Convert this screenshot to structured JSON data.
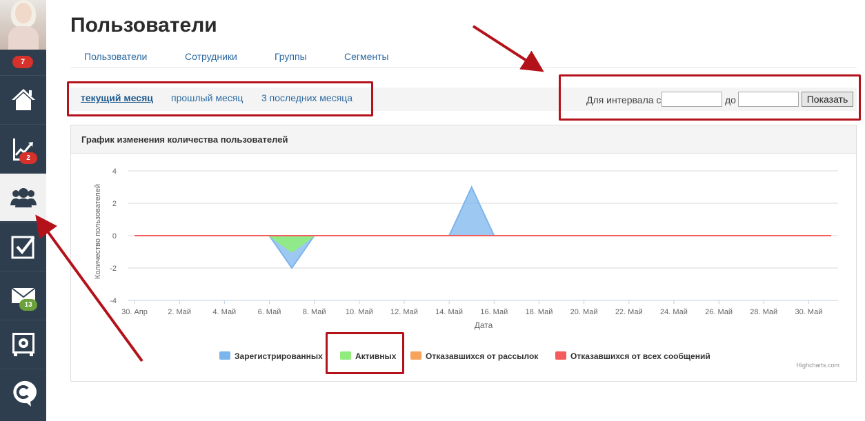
{
  "sidebar": {
    "top_badge": "7",
    "items": [
      {
        "name": "home",
        "icon": "home-icon",
        "badge": ""
      },
      {
        "name": "analytics",
        "icon": "chart-trend-icon",
        "badge": "2",
        "badge_color": "red"
      },
      {
        "name": "users",
        "icon": "users-group-icon",
        "badge": "",
        "active": true
      },
      {
        "name": "tasks",
        "icon": "checkbox-icon",
        "badge": ""
      },
      {
        "name": "mail",
        "icon": "envelope-icon",
        "badge": "13",
        "badge_color": "green"
      },
      {
        "name": "safe",
        "icon": "safe-icon",
        "badge": ""
      },
      {
        "name": "chat",
        "icon": "chat-c-icon",
        "badge": ""
      }
    ]
  },
  "header": {
    "title": "Пользователи",
    "tabs": [
      "Пользователи",
      "Сотрудники",
      "Группы",
      "Сегменты"
    ]
  },
  "period": {
    "links": [
      "текущий месяц",
      "прошлый месяц",
      "3 последних месяца"
    ],
    "current_index": 0,
    "interval_from_label": "Для интервала с",
    "interval_to_label": "до",
    "from_value": "",
    "to_value": "",
    "show_button": "Показать"
  },
  "panel": {
    "title": "График изменения количества пользователей"
  },
  "chart_data": {
    "type": "area",
    "title": "",
    "xlabel": "Дата",
    "ylabel": "Количество пользователей",
    "ylim": [
      -4,
      4
    ],
    "yticks": [
      4,
      2,
      0,
      -2,
      -4
    ],
    "x_tick_labels": [
      "30. Апр",
      "2. Май",
      "4. Май",
      "6. Май",
      "8. Май",
      "10. Май",
      "12. Май",
      "14. Май",
      "16. Май",
      "18. Май",
      "20. Май",
      "22. Май",
      "24. Май",
      "26. Май",
      "28. Май",
      "30. Май"
    ],
    "x_domain": [
      0,
      31
    ],
    "series": [
      {
        "name": "Зарегистрированных",
        "color": "#7cb5ec",
        "points": [
          [
            6,
            0
          ],
          [
            7,
            -2
          ],
          [
            8,
            0
          ],
          [
            14,
            0
          ],
          [
            15,
            3
          ],
          [
            16,
            0
          ]
        ]
      },
      {
        "name": "Активных",
        "color": "#90ed7d",
        "points": [
          [
            6,
            0
          ],
          [
            7,
            -1
          ],
          [
            8,
            0
          ]
        ]
      },
      {
        "name": "Отказавшихся от рассылок",
        "color": "#f7a35c",
        "points": []
      },
      {
        "name": "Отказавшихся от всех сообщений",
        "color": "#f45b5b",
        "points": [
          [
            0,
            0
          ],
          [
            31,
            0
          ]
        ]
      }
    ],
    "grid": true,
    "legend_position": "bottom",
    "credits": "Highcharts.com"
  },
  "colors": {
    "annotation": "#b3121a",
    "link": "#2c6aa0",
    "sidebar_bg": "#2e3e4e"
  }
}
